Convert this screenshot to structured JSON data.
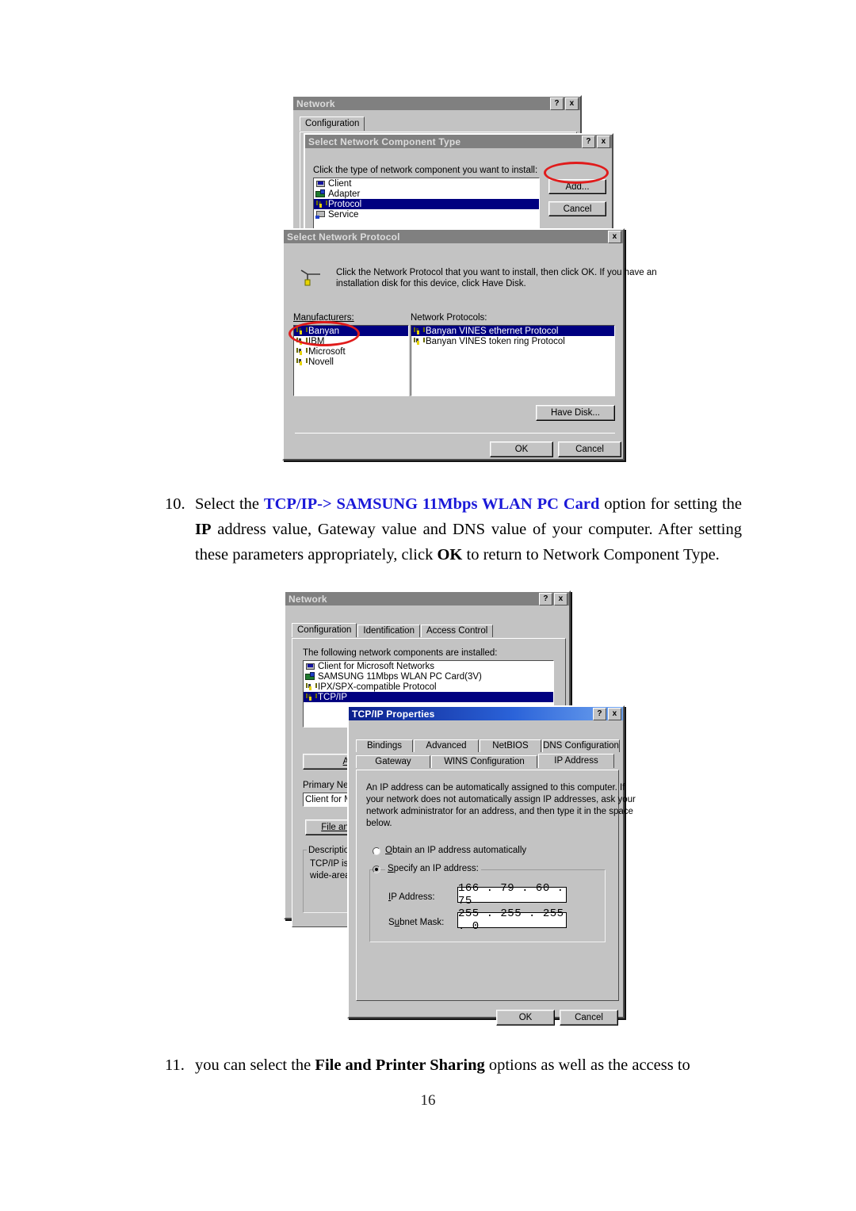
{
  "page": {
    "number": "16",
    "paragraphs": [
      {
        "num": "10.",
        "pre": "Select the ",
        "blue": "TCP/IP-> SAMSUNG 11Mbps WLAN PC Card",
        "mid1": " option for setting the ",
        "bold1": "IP",
        "mid2": " address value, Gateway value and DNS value of your computer. After setting these parameters appropriately, click ",
        "bold2": "OK",
        "tail": " to return to Network Component Type."
      },
      {
        "num": "11.",
        "pre": "you can select the ",
        "bold1": "File and Printer Sharing",
        "tail": " options as well as the access to"
      }
    ]
  },
  "figure1": {
    "network_dialog": {
      "title": "Network",
      "help_button": "?",
      "close_button": "x",
      "tabs": [
        {
          "label": "Configuration",
          "selected": true
        }
      ]
    },
    "component_type_dialog": {
      "title": "Select Network Component Type",
      "help_button": "?",
      "close_button": "x",
      "prompt": "Click the type of network component you want to install:",
      "items": [
        {
          "label": "Client",
          "icon": "client-icon",
          "selected": false
        },
        {
          "label": "Adapter",
          "icon": "adapter-icon",
          "selected": false
        },
        {
          "label": "Protocol",
          "icon": "protocol-icon",
          "selected": true
        },
        {
          "label": "Service",
          "icon": "service-icon",
          "selected": false
        }
      ],
      "add_button": "Add...",
      "cancel_button": "Cancel",
      "highlight_color": "#e01b1b"
    },
    "protocol_dialog": {
      "title": "Select Network Protocol",
      "close_button": "x",
      "instruction_line1": "Click the Network Protocol that you want to install, then click OK. If you have an",
      "instruction_line2": "installation disk for this device, click Have Disk.",
      "manufacturers_label": "Manufacturers:",
      "protocols_label": "Network Protocols:",
      "manufacturers": [
        {
          "label": "Banyan",
          "selected": true
        },
        {
          "label": "IBM",
          "selected": false
        },
        {
          "label": "Microsoft",
          "selected": false,
          "circled": true
        },
        {
          "label": "Novell",
          "selected": false
        }
      ],
      "protocols": [
        {
          "label": "Banyan VINES ethernet Protocol",
          "selected": true
        },
        {
          "label": "Banyan VINES token ring Protocol",
          "selected": false
        }
      ],
      "have_disk_button": "Have Disk...",
      "ok_button": "OK",
      "cancel_button": "Cancel"
    }
  },
  "figure2": {
    "network_dialog": {
      "title": "Network",
      "help_button": "?",
      "close_button": "x",
      "tabs": [
        {
          "label": "Configuration",
          "selected": true
        },
        {
          "label": "Identification",
          "selected": false
        },
        {
          "label": "Access Control",
          "selected": false
        }
      ],
      "components_label": "The following network components are installed:",
      "components": [
        {
          "label": "Client for Microsoft Networks",
          "icon": "client-icon",
          "selected": false
        },
        {
          "label": "SAMSUNG 11Mbps WLAN PC Card(3V)",
          "icon": "adapter-icon",
          "selected": false
        },
        {
          "label": "IPX/SPX-compatible Protocol",
          "icon": "protocol-icon",
          "selected": false
        },
        {
          "label": "TCP/IP",
          "icon": "protocol-icon",
          "selected": true
        }
      ],
      "add_button": "Add",
      "primary_network_label": "Primary Net",
      "primary_network_value": "Client for Mi",
      "file_print_button": "File an",
      "description_label": "Descriptio",
      "description_line1": "TCP/IP is",
      "description_line2": "wide-area"
    },
    "tcpip_dialog": {
      "title": "TCP/IP Properties",
      "help_button": "?",
      "close_button": "x",
      "tabs_row1": [
        {
          "label": "Bindings",
          "selected": false
        },
        {
          "label": "Advanced",
          "selected": false
        },
        {
          "label": "NetBIOS",
          "selected": false
        },
        {
          "label": "DNS Configuration",
          "selected": false
        }
      ],
      "tabs_row2": [
        {
          "label": "Gateway",
          "selected": false
        },
        {
          "label": "WINS Configuration",
          "selected": false
        },
        {
          "label": "IP Address",
          "selected": true
        }
      ],
      "info_line1": "An IP address can be automatically assigned to this computer.  If",
      "info_line2": "your network does not automatically assign IP addresses, ask your",
      "info_line3": "network administrator for an address, and then type it in the space",
      "info_line4": "below.",
      "radio_auto_label": "Obtain an IP address automatically",
      "radio_auto_selected": false,
      "radio_specify_label": "Specify an IP address:",
      "radio_specify_selected": true,
      "ip_address_label": "IP Address:",
      "ip_address_value": "166 .  79  .  60  .  75",
      "subnet_mask_label": "Subnet Mask:",
      "subnet_mask_value": "255 . 255 . 255 .   0",
      "ok_button": "OK",
      "cancel_button": "Cancel"
    }
  }
}
